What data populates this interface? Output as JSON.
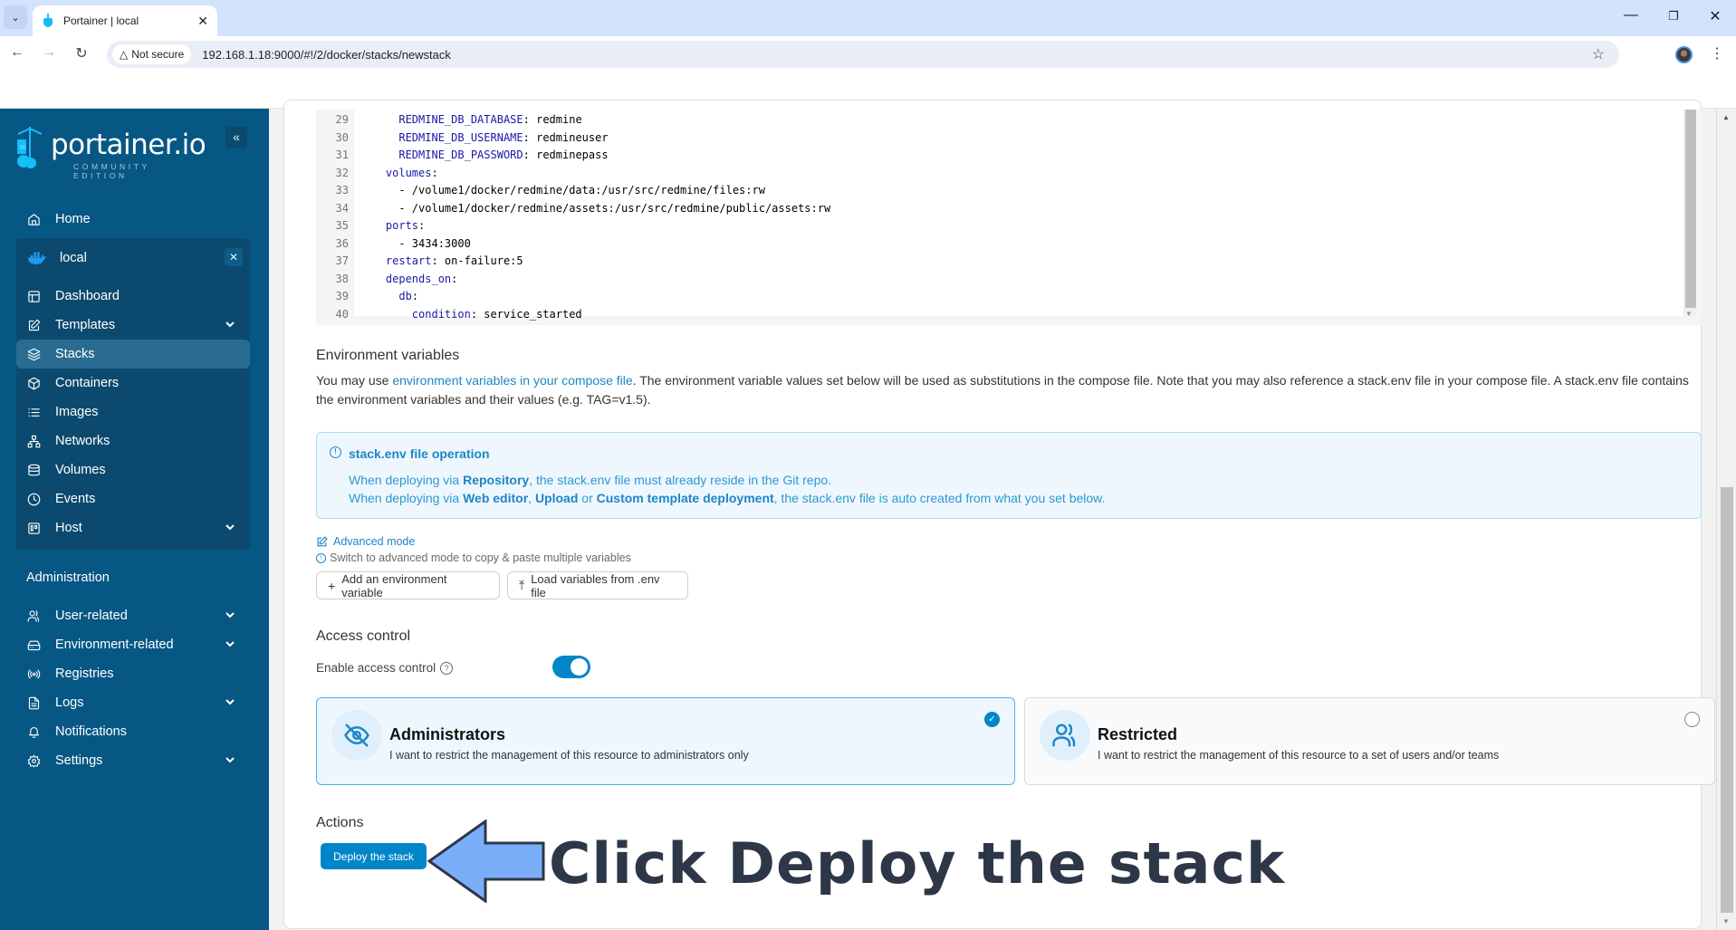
{
  "browser": {
    "tab_title": "Portainer | local",
    "security_label": "Not secure",
    "url": "192.168.1.18:9000/#!/2/docker/stacks/newstack"
  },
  "sidebar": {
    "logo_text": "portainer.io",
    "logo_subtitle": "COMMUNITY EDITION",
    "home_label": "Home",
    "environment_name": "local",
    "env_items": [
      {
        "label": "Dashboard",
        "icon": "dashboard-icon"
      },
      {
        "label": "Templates",
        "icon": "edit-icon",
        "expandable": true
      },
      {
        "label": "Stacks",
        "icon": "layers-icon",
        "active": true
      },
      {
        "label": "Containers",
        "icon": "box-icon"
      },
      {
        "label": "Images",
        "icon": "list-icon"
      },
      {
        "label": "Networks",
        "icon": "network-icon"
      },
      {
        "label": "Volumes",
        "icon": "database-icon"
      },
      {
        "label": "Events",
        "icon": "clock-icon"
      },
      {
        "label": "Host",
        "icon": "trello-icon",
        "expandable": true
      }
    ],
    "admin_title": "Administration",
    "admin_items": [
      {
        "label": "User-related",
        "icon": "users-icon",
        "expandable": true
      },
      {
        "label": "Environment-related",
        "icon": "hard-drive-icon",
        "expandable": true
      },
      {
        "label": "Registries",
        "icon": "radio-icon"
      },
      {
        "label": "Logs",
        "icon": "file-text-icon",
        "expandable": true
      },
      {
        "label": "Notifications",
        "icon": "bell-icon"
      },
      {
        "label": "Settings",
        "icon": "settings-icon",
        "expandable": true
      }
    ]
  },
  "editor": {
    "lines": [
      {
        "n": "29",
        "indent": "      ",
        "key": "REDMINE_DB_DATABASE",
        "rest": ": redmine"
      },
      {
        "n": "30",
        "indent": "      ",
        "key": "REDMINE_DB_USERNAME",
        "rest": ": redmineuser"
      },
      {
        "n": "31",
        "indent": "      ",
        "key": "REDMINE_DB_PASSWORD",
        "rest": ": redminepass"
      },
      {
        "n": "32",
        "indent": "    ",
        "key": "volumes",
        "rest": ":"
      },
      {
        "n": "33",
        "indent": "      ",
        "key": "",
        "rest": "- /volume1/docker/redmine/data:/usr/src/redmine/files:rw"
      },
      {
        "n": "34",
        "indent": "      ",
        "key": "",
        "rest": "- /volume1/docker/redmine/assets:/usr/src/redmine/public/assets:rw"
      },
      {
        "n": "35",
        "indent": "    ",
        "key": "ports",
        "rest": ":"
      },
      {
        "n": "36",
        "indent": "      ",
        "key": "",
        "rest": "- 3434:3000"
      },
      {
        "n": "37",
        "indent": "    ",
        "key": "restart",
        "rest": ": on-failure:5"
      },
      {
        "n": "38",
        "indent": "    ",
        "key": "depends_on",
        "rest": ":"
      },
      {
        "n": "39",
        "indent": "      ",
        "key": "db",
        "rest": ":"
      },
      {
        "n": "40",
        "indent": "        ",
        "key": "condition",
        "rest": ": service_started"
      }
    ]
  },
  "env_vars": {
    "title": "Environment variables",
    "desc_prefix": "You may use ",
    "desc_link": "environment variables in your compose file",
    "desc_suffix": ". The environment variable values set below will be used as substitutions in the compose file. Note that you may also reference a stack.env file in your compose file. A stack.env file contains the environment variables and their values (e.g. TAG=v1.5).",
    "info_title": "stack.env file operation",
    "info_line1_prefix": "When deploying via ",
    "info_line1_bold": "Repository",
    "info_line1_suffix": ", the stack.env file must already reside in the Git repo.",
    "info_line2_prefix": "When deploying via ",
    "info_line2_bold1": "Web editor",
    "info_line2_sep1": ", ",
    "info_line2_bold2": "Upload",
    "info_line2_sep2": " or ",
    "info_line2_bold3": "Custom template deployment",
    "info_line2_suffix": ", the stack.env file is auto created from what you set below.",
    "advanced_mode": "Advanced mode",
    "advanced_hint": "Switch to advanced mode to copy & paste multiple variables",
    "add_button": "Add an environment variable",
    "load_button": "Load variables from .env file"
  },
  "access_control": {
    "title": "Access control",
    "enable_label": "Enable access control",
    "enabled": true,
    "options": [
      {
        "title": "Administrators",
        "desc": "I want to restrict the management of this resource to administrators only",
        "selected": true
      },
      {
        "title": "Restricted",
        "desc": "I want to restrict the management of this resource to a set of users and/or teams",
        "selected": false
      }
    ]
  },
  "actions": {
    "title": "Actions",
    "deploy_button": "Deploy the stack"
  },
  "annotation": {
    "text": "Click Deploy the stack"
  },
  "colors": {
    "sidebar_bg": "#065784",
    "accent": "#0086c9",
    "annotation_arrow": "#7aaef9",
    "annotation_text": "#2d3748"
  }
}
